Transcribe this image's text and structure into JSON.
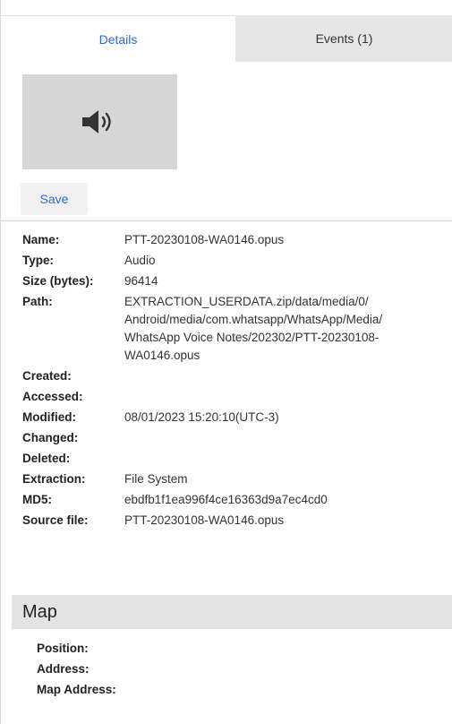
{
  "tabs": [
    {
      "label": "Details",
      "active": true
    },
    {
      "label": "Events (1)",
      "active": false
    }
  ],
  "media": {
    "icon": "speaker-icon"
  },
  "actions": {
    "save_label": "Save"
  },
  "properties": [
    {
      "label": "Name:",
      "value": "PTT-20230108-WA0146.opus"
    },
    {
      "label": "Type:",
      "value": "Audio"
    },
    {
      "label": "Size (bytes):",
      "value": "96414"
    },
    {
      "label": "Path:",
      "value_lines": [
        "EXTRACTION_USERDATA.zip/data/media/0/",
        "Android/media/com.whatsapp/WhatsApp/Media/",
        "WhatsApp Voice Notes/202302/PTT-20230108-",
        "WA0146.opus"
      ]
    },
    {
      "label": "Created:",
      "value": ""
    },
    {
      "label": "Accessed:",
      "value": ""
    },
    {
      "label": "Modified:",
      "value": "08/01/2023 15:20:10(UTC-3)"
    },
    {
      "label": "Changed:",
      "value": ""
    },
    {
      "label": "Deleted:",
      "value": ""
    },
    {
      "label": "Extraction:",
      "value": "File System"
    },
    {
      "label": "MD5:",
      "value": "ebdfb1f1ea996f4ce16363d9a7ec4cd0"
    },
    {
      "label": "Source file:",
      "value": "PTT-20230108-WA0146.opus"
    }
  ],
  "map": {
    "title": "Map",
    "fields": [
      {
        "label": "Position:",
        "value": ""
      },
      {
        "label": "Address:",
        "value": ""
      },
      {
        "label": "Map Address:",
        "value": ""
      }
    ]
  },
  "colors": {
    "accent": "#2f6bbf",
    "tab_inactive": "#e6e6e6",
    "thumb_bg": "#d6d6d6",
    "section_header": "#e3e3e3"
  }
}
